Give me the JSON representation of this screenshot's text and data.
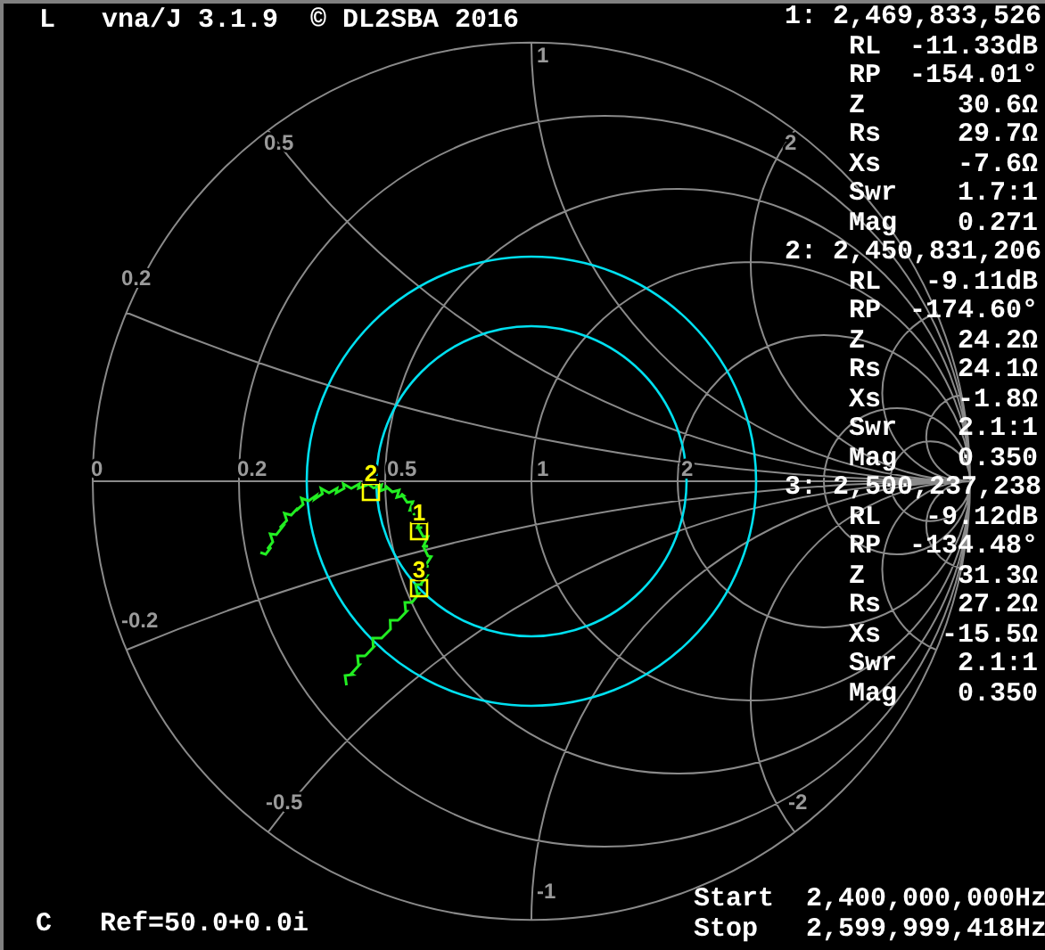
{
  "header": {
    "mode": "L",
    "title": "vna/J 3.1.9  © DL2SBA 2016"
  },
  "scale_labels": [
    {
      "text": "1"
    },
    {
      "text": "0.5"
    },
    {
      "text": "0.2"
    },
    {
      "text": "2"
    },
    {
      "text": "0"
    },
    {
      "text": "0.2"
    },
    {
      "text": "0.5"
    },
    {
      "text": "1"
    },
    {
      "text": "2"
    },
    {
      "text": "-0.2"
    },
    {
      "text": "-0.5"
    },
    {
      "text": "-2"
    },
    {
      "text": "-1"
    }
  ],
  "chart_markers": [
    {
      "label": "1"
    },
    {
      "label": "2"
    },
    {
      "label": "3"
    }
  ],
  "readouts": [
    {
      "header": "1: 2,469,833,526",
      "rows": [
        {
          "name": "RL",
          "value": "-11.33dB"
        },
        {
          "name": "RP",
          "value": "-154.01°"
        },
        {
          "name": "Z",
          "value": "30.6Ω"
        },
        {
          "name": "Rs",
          "value": "29.7Ω"
        },
        {
          "name": "Xs",
          "value": "-7.6Ω"
        },
        {
          "name": "Swr",
          "value": "1.7:1"
        },
        {
          "name": "Mag",
          "value": "0.271"
        }
      ]
    },
    {
      "header": "2: 2,450,831,206",
      "rows": [
        {
          "name": "RL",
          "value": "-9.11dB"
        },
        {
          "name": "RP",
          "value": "-174.60°"
        },
        {
          "name": "Z",
          "value": "24.2Ω"
        },
        {
          "name": "Rs",
          "value": "24.1Ω"
        },
        {
          "name": "Xs",
          "value": "-1.8Ω"
        },
        {
          "name": "Swr",
          "value": "2.1:1"
        },
        {
          "name": "Mag",
          "value": "0.350"
        }
      ]
    },
    {
      "header": "3: 2,500,237,238",
      "rows": [
        {
          "name": "RL",
          "value": "-9.12dB"
        },
        {
          "name": "RP",
          "value": "-134.48°"
        },
        {
          "name": "Z",
          "value": "31.3Ω"
        },
        {
          "name": "Rs",
          "value": "27.2Ω"
        },
        {
          "name": "Xs",
          "value": "-15.5Ω"
        },
        {
          "name": "Swr",
          "value": "2.1:1"
        },
        {
          "name": "Mag",
          "value": "0.350"
        }
      ]
    }
  ],
  "footer": {
    "mode": "C",
    "reference": "Ref=50.0+0.0i",
    "start_label": "Start",
    "start": "2,400,000,000Hz",
    "stop_label": "Stop",
    "stop": "2,599,999,418Hz"
  }
}
